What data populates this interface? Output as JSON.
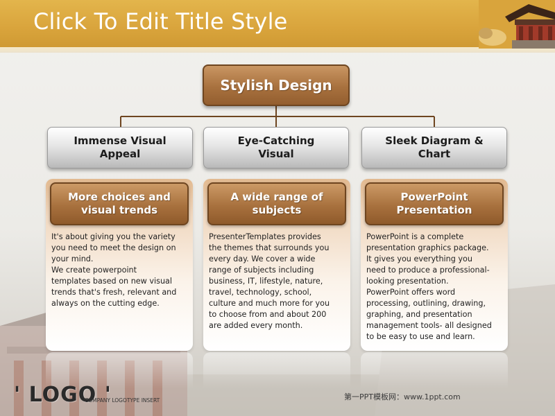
{
  "slide": {
    "title": "Click To Edit Title Style"
  },
  "root": {
    "label": "Stylish Design"
  },
  "columns": [
    {
      "heading": "Immense Visual\nAppeal",
      "subheading": "More choices and\nvisual trends",
      "body": "It's about giving you the variety\nyou need to meet the design on\nyour mind.\nWe create powerpoint\ntemplates based on new visual\ntrends that's fresh, relevant and\nalways on the cutting edge."
    },
    {
      "heading": "Eye-Catching\nVisual",
      "subheading": "A wide range of\nsubjects",
      "body": "PresenterTemplates  provides\nthe themes that surrounds you\nevery day. We cover a wide\nrange of subjects including\nbusiness, IT, lifestyle, nature,\ntravel, technology, school,\nculture and much more  for you\nto choose from and about 200\nare added  every month."
    },
    {
      "heading": "Sleek Diagram &\nChart",
      "subheading": "PowerPoint\nPresentation",
      "body": "PowerPoint is a complete\npresentation graphics package.\nIt gives you everything  you\nneed to produce a professional-\nlooking presentation.\nPowerPoint offers word\nprocessing, outlining, drawing,\ngraphing, and presentation\nmanagement tools- all designed\nto be easy to use and learn."
    }
  ],
  "footer": {
    "logo": "' LOGO '",
    "logo_tagline": "COMPANY LOGOTYPE  INSERT",
    "watermark": "第一PPT模板网：www.1ppt.com"
  },
  "colors": {
    "header": "#d9a43c",
    "brown_box": "#a8713e",
    "grey_box": "#e6e6e6",
    "connector": "#6e4520"
  }
}
